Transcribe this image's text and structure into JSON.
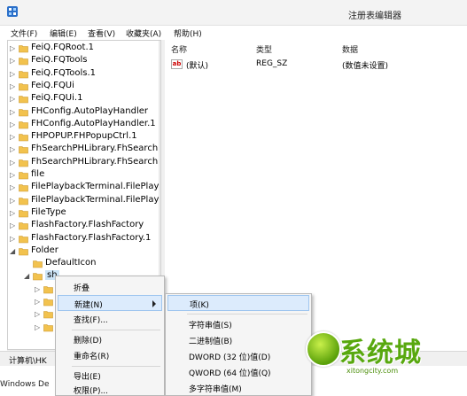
{
  "window": {
    "title": "注册表编辑器"
  },
  "menu": [
    {
      "label": "文件(F)"
    },
    {
      "label": "编辑(E)"
    },
    {
      "label": "查看(V)"
    },
    {
      "label": "收藏夹(A)"
    },
    {
      "label": "帮助(H)"
    }
  ],
  "tree": {
    "items": [
      {
        "label": "FeiQ.FQRoot.1"
      },
      {
        "label": "FeiQ.FQTools"
      },
      {
        "label": "FeiQ.FQTools.1"
      },
      {
        "label": "FeiQ.FQUi"
      },
      {
        "label": "FeiQ.FQUi.1"
      },
      {
        "label": "FHConfig.AutoPlayHandler"
      },
      {
        "label": "FHConfig.AutoPlayHandler.1"
      },
      {
        "label": "FHPOPUP.FHPopupCtrl.1"
      },
      {
        "label": "FhSearchPHLibrary.FhSearchI"
      },
      {
        "label": "FhSearchPHLibrary.FhSearchI"
      },
      {
        "label": "file"
      },
      {
        "label": "FilePlaybackTerminal.FilePlay"
      },
      {
        "label": "FilePlaybackTerminal.FilePlay"
      },
      {
        "label": "FileType"
      },
      {
        "label": "FlashFactory.FlashFactory"
      },
      {
        "label": "FlashFactory.FlashFactory.1"
      },
      {
        "label": "Folder"
      },
      {
        "label": "DefaultIcon"
      },
      {
        "label": "sh"
      }
    ]
  },
  "list": {
    "headers": {
      "name": "名称",
      "type": "类型",
      "data": "数据"
    },
    "rows": [
      {
        "name": "(默认)",
        "type": "REG_SZ",
        "data": "(数值未设置)"
      }
    ]
  },
  "status": {
    "path": "计算机\\HK",
    "below": "Windows De"
  },
  "context_menu": {
    "items": [
      {
        "label": "折叠"
      },
      {
        "label": "新建(N)"
      },
      {
        "label": "查找(F)..."
      },
      {
        "label": "删除(D)"
      },
      {
        "label": "重命名(R)"
      },
      {
        "label": "导出(E)"
      },
      {
        "label": "权限(P)..."
      }
    ]
  },
  "submenu": {
    "items": [
      {
        "label": "项(K)"
      },
      {
        "label": "字符串值(S)"
      },
      {
        "label": "二进制值(B)"
      },
      {
        "label": "DWORD (32 位)值(D)"
      },
      {
        "label": "QWORD (64 位)值(Q)"
      },
      {
        "label": "多字符串值(M)"
      }
    ]
  },
  "watermark": {
    "logo_text": "系统城",
    "url": "xitongcity.com"
  },
  "colors": {
    "folder": "#f2c24e",
    "highlight": "#dcebfc",
    "highlight_border": "#9fc6ef",
    "watermark_green": "#58a80e"
  }
}
